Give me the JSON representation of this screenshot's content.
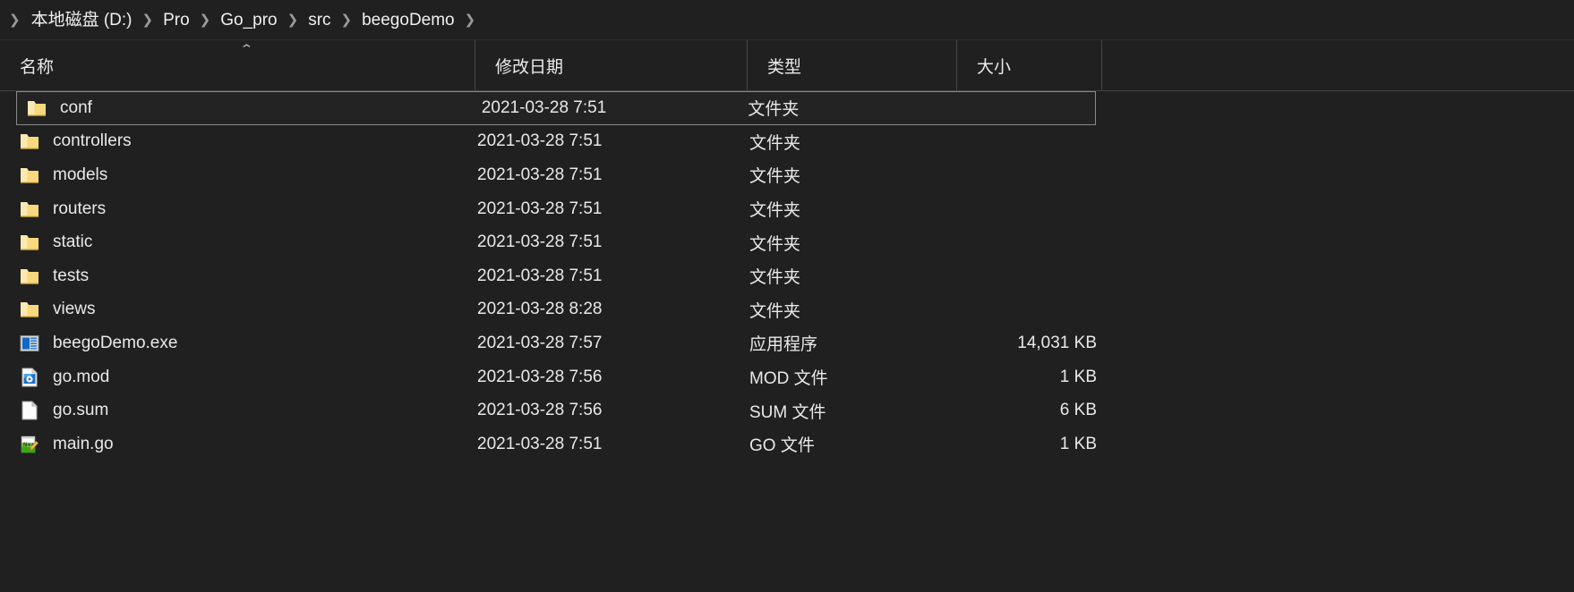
{
  "breadcrumb": {
    "separator": "❯",
    "items": [
      {
        "label": "本地磁盘 (D:)"
      },
      {
        "label": "Pro"
      },
      {
        "label": "Go_pro"
      },
      {
        "label": "src"
      },
      {
        "label": "beegoDemo"
      }
    ]
  },
  "columns": {
    "name": "名称",
    "date_modified": "修改日期",
    "type": "类型",
    "size": "大小",
    "sort_caret": "⌃",
    "sort_column": "name",
    "sort_direction": "ascending"
  },
  "colors": {
    "background": "#202020",
    "text": "#e9e9e9",
    "separator": "#9a9a9a",
    "grid_line": "#484848",
    "focus_border": "#8a8a8a",
    "folder_body": "#f5d778",
    "folder_tab": "#fbe9a8",
    "exe_blue": "#1268c8",
    "document_white": "#fdfdfd",
    "notepadpp_green": "#5ac62b"
  },
  "rows": [
    {
      "name": "conf",
      "icon": "folder-icon",
      "date": "2021-03-28 7:51",
      "type": "文件夹",
      "size": "",
      "focused": true
    },
    {
      "name": "controllers",
      "icon": "folder-icon",
      "date": "2021-03-28 7:51",
      "type": "文件夹",
      "size": "",
      "focused": false
    },
    {
      "name": "models",
      "icon": "folder-icon",
      "date": "2021-03-28 7:51",
      "type": "文件夹",
      "size": "",
      "focused": false
    },
    {
      "name": "routers",
      "icon": "folder-icon",
      "date": "2021-03-28 7:51",
      "type": "文件夹",
      "size": "",
      "focused": false
    },
    {
      "name": "static",
      "icon": "folder-icon",
      "date": "2021-03-28 7:51",
      "type": "文件夹",
      "size": "",
      "focused": false
    },
    {
      "name": "tests",
      "icon": "folder-icon",
      "date": "2021-03-28 7:51",
      "type": "文件夹",
      "size": "",
      "focused": false
    },
    {
      "name": "views",
      "icon": "folder-icon",
      "date": "2021-03-28 8:28",
      "type": "文件夹",
      "size": "",
      "focused": false
    },
    {
      "name": "beegoDemo.exe",
      "icon": "application-icon",
      "date": "2021-03-28 7:57",
      "type": "应用程序",
      "size": "14,031 KB",
      "focused": false
    },
    {
      "name": "go.mod",
      "icon": "media-file-icon",
      "date": "2021-03-28 7:56",
      "type": "MOD 文件",
      "size": "1 KB",
      "focused": false
    },
    {
      "name": "go.sum",
      "icon": "blank-file-icon",
      "date": "2021-03-28 7:56",
      "type": "SUM 文件",
      "size": "6 KB",
      "focused": false
    },
    {
      "name": "main.go",
      "icon": "notepadpp-icon",
      "date": "2021-03-28 7:51",
      "type": "GO 文件",
      "size": "1 KB",
      "focused": false
    }
  ]
}
